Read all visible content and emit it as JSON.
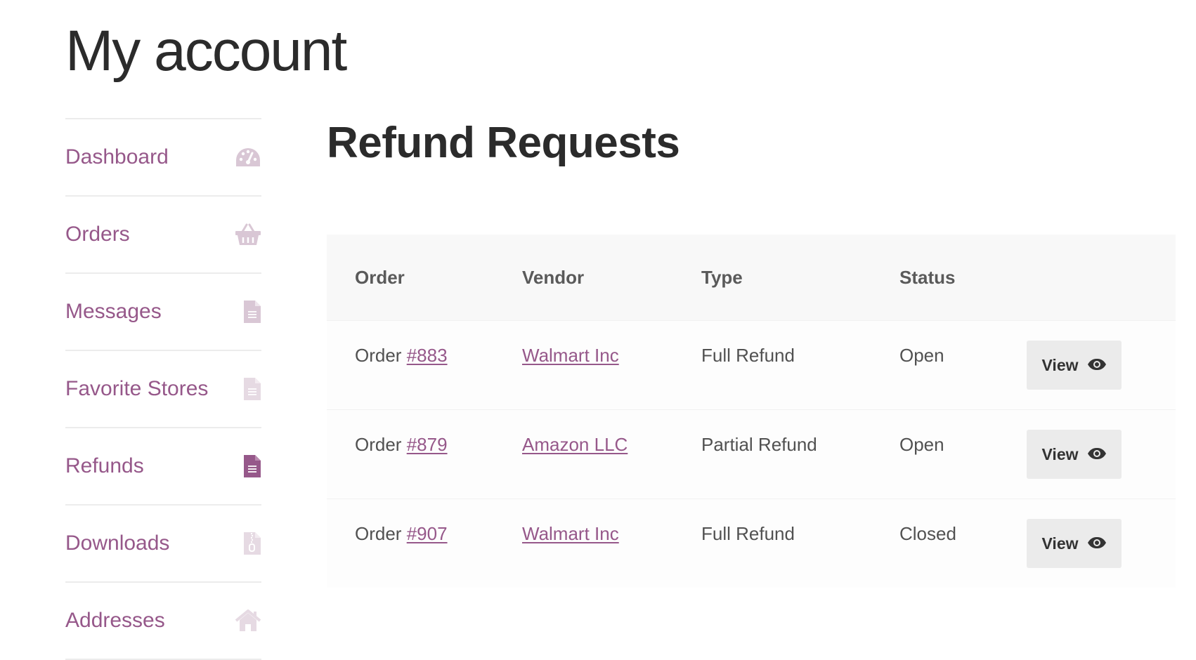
{
  "page": {
    "title": "My account"
  },
  "nav": {
    "items": [
      {
        "label": "Dashboard",
        "icon": "dashboard-gauge-icon"
      },
      {
        "label": "Orders",
        "icon": "basket-icon"
      },
      {
        "label": "Messages",
        "icon": "document-icon"
      },
      {
        "label": "Favorite Stores",
        "icon": "document-icon"
      },
      {
        "label": "Refunds",
        "icon": "document-icon",
        "active": true
      },
      {
        "label": "Downloads",
        "icon": "zip-file-icon"
      },
      {
        "label": "Addresses",
        "icon": "home-icon"
      }
    ]
  },
  "main": {
    "title": "Refund Requests",
    "table": {
      "headers": {
        "order": "Order",
        "vendor": "Vendor",
        "type": "Type",
        "status": "Status"
      },
      "rows": [
        {
          "order_prefix": "Order",
          "order_number": "#883",
          "vendor": "Walmart Inc",
          "type": "Full Refund",
          "status": "Open",
          "action": "View"
        },
        {
          "order_prefix": "Order",
          "order_number": "#879",
          "vendor": "Amazon LLC",
          "type": "Partial Refund",
          "status": "Open",
          "action": "View"
        },
        {
          "order_prefix": "Order",
          "order_number": "#907",
          "vendor": "Walmart Inc",
          "type": "Full Refund",
          "status": "Closed",
          "action": "View"
        }
      ]
    }
  },
  "colors": {
    "accent": "#96588a",
    "icon_muted": "#d9c7d5",
    "heading": "#2b2b2b",
    "text": "#515151"
  }
}
